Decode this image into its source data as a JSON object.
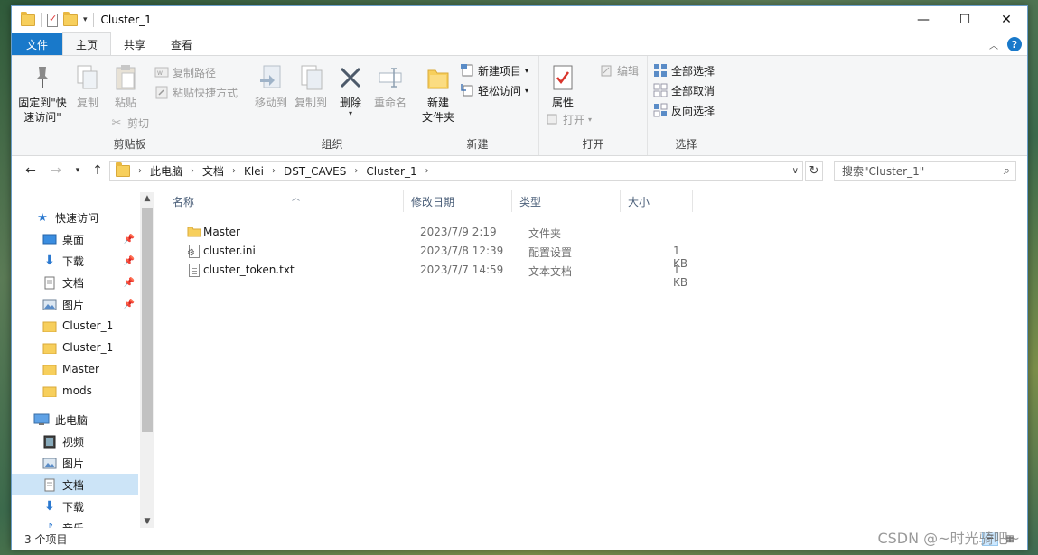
{
  "window": {
    "title": "Cluster_1",
    "controls": {
      "minimize": "—",
      "maximize": "☐",
      "close": "✕"
    }
  },
  "ribbon_tabs": [
    {
      "label": "文件"
    },
    {
      "label": "主页"
    },
    {
      "label": "共享"
    },
    {
      "label": "查看"
    }
  ],
  "ribbon": {
    "clipboard": {
      "pin_label_1": "固定到\"快",
      "pin_label_2": "速访问\"",
      "copy": "复制",
      "paste": "粘贴",
      "copy_path": "复制路径",
      "paste_shortcut": "粘贴快捷方式",
      "cut": "剪切",
      "group": "剪贴板"
    },
    "organize": {
      "move_to": "移动到",
      "copy_to": "复制到",
      "delete": "删除",
      "rename": "重命名",
      "group": "组织"
    },
    "new": {
      "new_folder_1": "新建",
      "new_folder_2": "文件夹",
      "new_item": "新建项目",
      "easy_access": "轻松访问",
      "group": "新建"
    },
    "open": {
      "properties": "属性",
      "open": "打开",
      "edit": "编辑",
      "group": "打开"
    },
    "select": {
      "select_all": "全部选择",
      "select_none": "全部取消",
      "invert": "反向选择",
      "group": "选择"
    }
  },
  "address": {
    "crumbs": [
      "此电脑",
      "文档",
      "Klei",
      "DST_CAVES",
      "Cluster_1"
    ]
  },
  "search": {
    "placeholder": "搜索\"Cluster_1\""
  },
  "sidebar": {
    "items": [
      {
        "label": "快速访问",
        "icon": "star-icon"
      },
      {
        "label": "桌面",
        "icon": "desktop-icon",
        "pinned": true
      },
      {
        "label": "下载",
        "icon": "download-icon",
        "pinned": true
      },
      {
        "label": "文档",
        "icon": "document-icon",
        "pinned": true
      },
      {
        "label": "图片",
        "icon": "picture-icon",
        "pinned": true
      },
      {
        "label": "Cluster_1",
        "icon": "folder-icon"
      },
      {
        "label": "Cluster_1",
        "icon": "folder-icon"
      },
      {
        "label": "Master",
        "icon": "folder-icon"
      },
      {
        "label": "mods",
        "icon": "folder-icon"
      },
      {
        "label": "此电脑",
        "icon": "computer-icon"
      },
      {
        "label": "视频",
        "icon": "video-icon"
      },
      {
        "label": "图片",
        "icon": "picture-icon"
      },
      {
        "label": "文档",
        "icon": "document-icon",
        "selected": true
      },
      {
        "label": "下载",
        "icon": "download-icon"
      },
      {
        "label": "音乐",
        "icon": "music-icon"
      }
    ]
  },
  "columns": {
    "name": "名称",
    "date": "修改日期",
    "type": "类型",
    "size": "大小"
  },
  "files": [
    {
      "name": "Master",
      "date": "2023/7/9 2:19",
      "type": "文件夹",
      "size": "",
      "icon": "folder-icon"
    },
    {
      "name": "cluster.ini",
      "date": "2023/7/8 12:39",
      "type": "配置设置",
      "size": "1 KB",
      "icon": "config-file-icon"
    },
    {
      "name": "cluster_token.txt",
      "date": "2023/7/7 14:59",
      "type": "文本文档",
      "size": "1 KB",
      "icon": "text-file-icon"
    }
  ],
  "status": {
    "count": "3 个项目"
  },
  "watermark": "CSDN @~时光骑吧~",
  "colors": {
    "accent": "#1979ca",
    "selection": "#cce4f7",
    "folder": "#f7cf5c"
  }
}
